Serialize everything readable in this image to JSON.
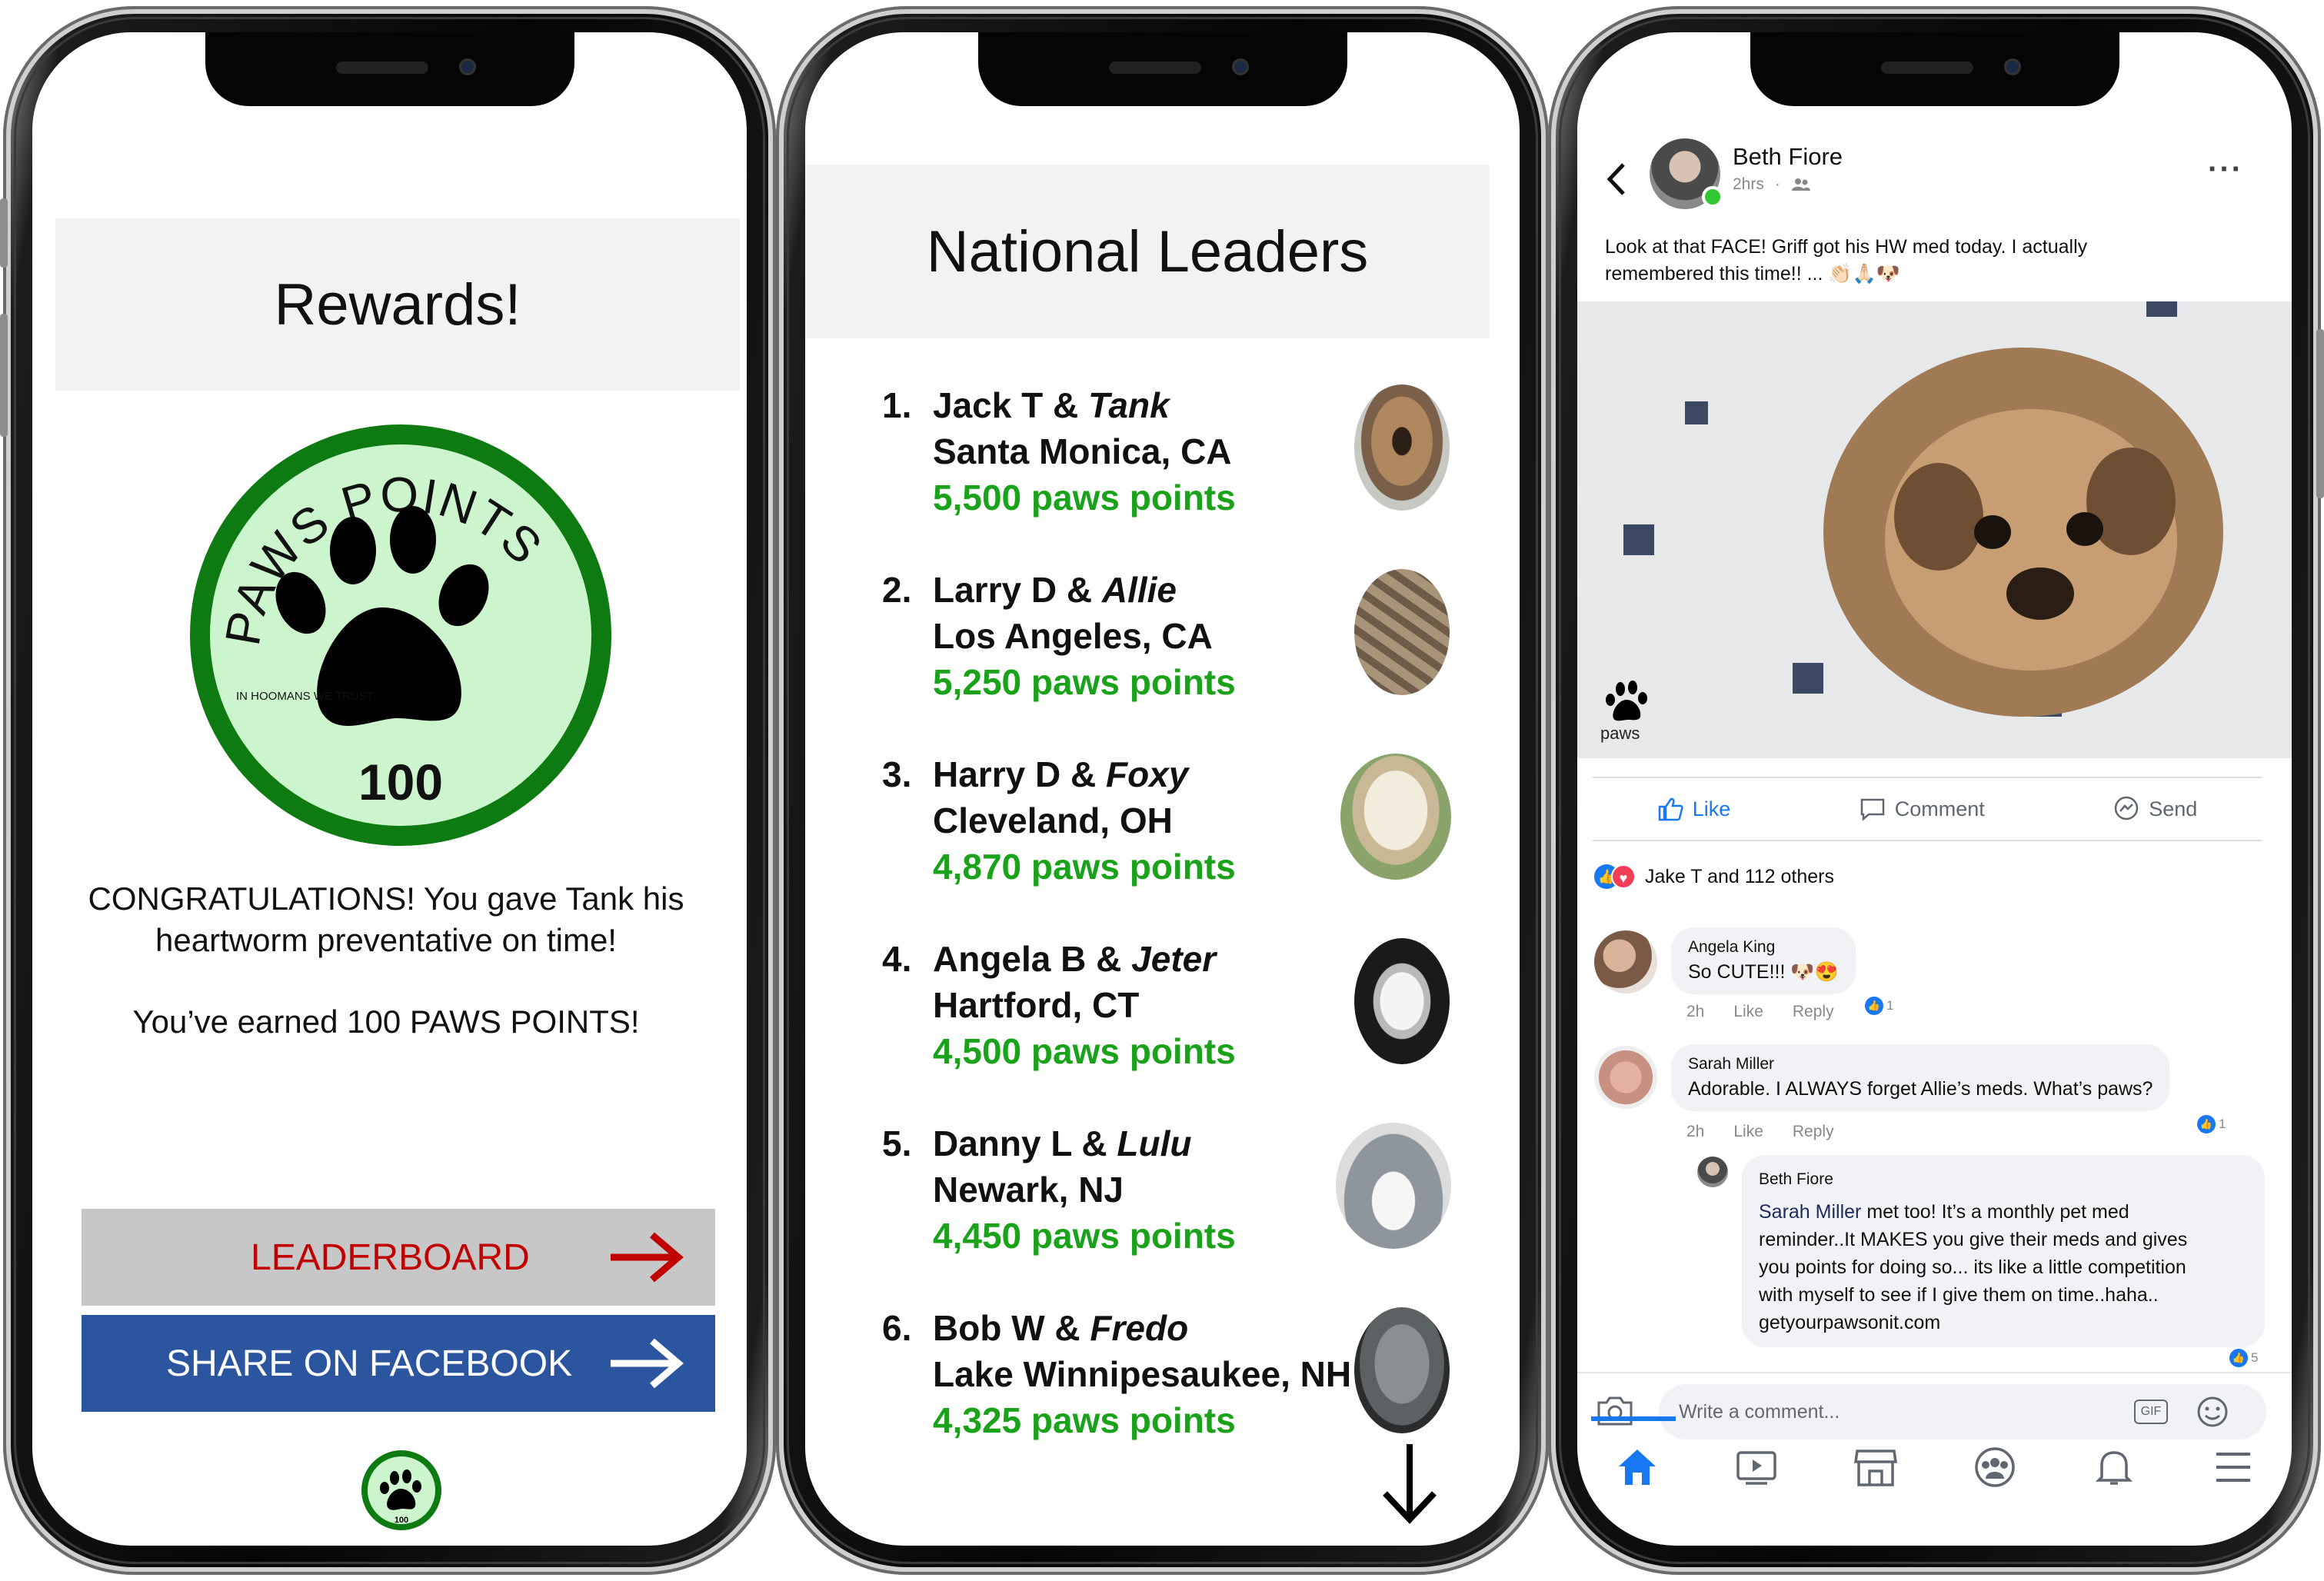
{
  "rewards_screen": {
    "title": "Rewards!",
    "badge": {
      "arc_text": "PAWS POINTS",
      "motto": "IN HOOMANS WE TRUST",
      "points": "100"
    },
    "congrats": "CONGRATULATIONS! You gave Tank his heartworm preventative on time!",
    "earned": "You’ve earned 100 PAWS POINTS!",
    "leaderboard_button": "LEADERBOARD",
    "share_button": "SHARE ON FACEBOOK",
    "mini_badge_points": "100",
    "colors": {
      "badge_ring": "#0d7a12",
      "badge_fill": "#cdf5cd",
      "leaderboard_text": "#c00000",
      "facebook_blue": "#2c55a0"
    }
  },
  "leaders_screen": {
    "title": "National Leaders",
    "leaders": [
      {
        "rank": "1.",
        "owner": "Jack T &",
        "pet": "Tank",
        "location": "Santa Monica, CA",
        "points": "5,500 paws points"
      },
      {
        "rank": "2.",
        "owner": "Larry D &",
        "pet": "Allie",
        "location": "Los Angeles, CA",
        "points": "5,250 paws points"
      },
      {
        "rank": "3.",
        "owner": "Harry D &",
        "pet": "Foxy",
        "location": "Cleveland, OH",
        "points": "4,870 paws points"
      },
      {
        "rank": "4.",
        "owner": "Angela B &",
        "pet": "Jeter",
        "location": "Hartford, CT",
        "points": "4,500 paws points"
      },
      {
        "rank": "5.",
        "owner": "Danny L &",
        "pet": "Lulu",
        "location": "Newark, NJ",
        "points": "4,450 paws points"
      },
      {
        "rank": "6.",
        "owner": "Bob W &",
        "pet": "Fredo",
        "location": "Lake Winnipesaukee, NH",
        "points": "4,325 paws points"
      }
    ],
    "colors": {
      "points_green": "#1aa21a"
    }
  },
  "facebook_screen": {
    "author": "Beth Fiore",
    "time": "2hrs",
    "post_text_1": "Look at that FACE! Griff got his HW med today. I actually",
    "post_text_2": "remembered this time!! ... 👏🏻🙏🏻🐶",
    "watermark": "paws",
    "actions": {
      "like": "Like",
      "comment": "Comment",
      "send": "Send"
    },
    "reactions": "Jake T and 112 others",
    "comments": [
      {
        "name": "Angela King",
        "text": "So CUTE!!! 🐶😍",
        "time": "2h",
        "like": "Like",
        "reply": "Reply",
        "count": "1"
      },
      {
        "name": "Sarah Miller",
        "text": "Adorable. I ALWAYS forget Allie’s meds. What’s paws?",
        "time": "2h",
        "like": "Like",
        "reply": "Reply",
        "count": "1"
      }
    ],
    "reply": {
      "name": "Beth Fiore",
      "mention": "Sarah Miller",
      "line1": " met too! It’s a monthly pet med",
      "line2": "reminder..It MAKES you give their meds and gives",
      "line3": "you points for doing so... its like a little competition",
      "line4": "with myself to see if I give them on time..haha..",
      "line5": "getyourpawsonit.com",
      "count": "5"
    },
    "composer_placeholder": "Write a comment...",
    "gif_label": "GIF",
    "tabs": [
      "home-icon",
      "video-icon",
      "marketplace-icon",
      "groups-icon",
      "bell-icon",
      "menu-icon"
    ],
    "colors": {
      "fb_blue": "#1877f2",
      "online_green": "#31c831"
    }
  }
}
